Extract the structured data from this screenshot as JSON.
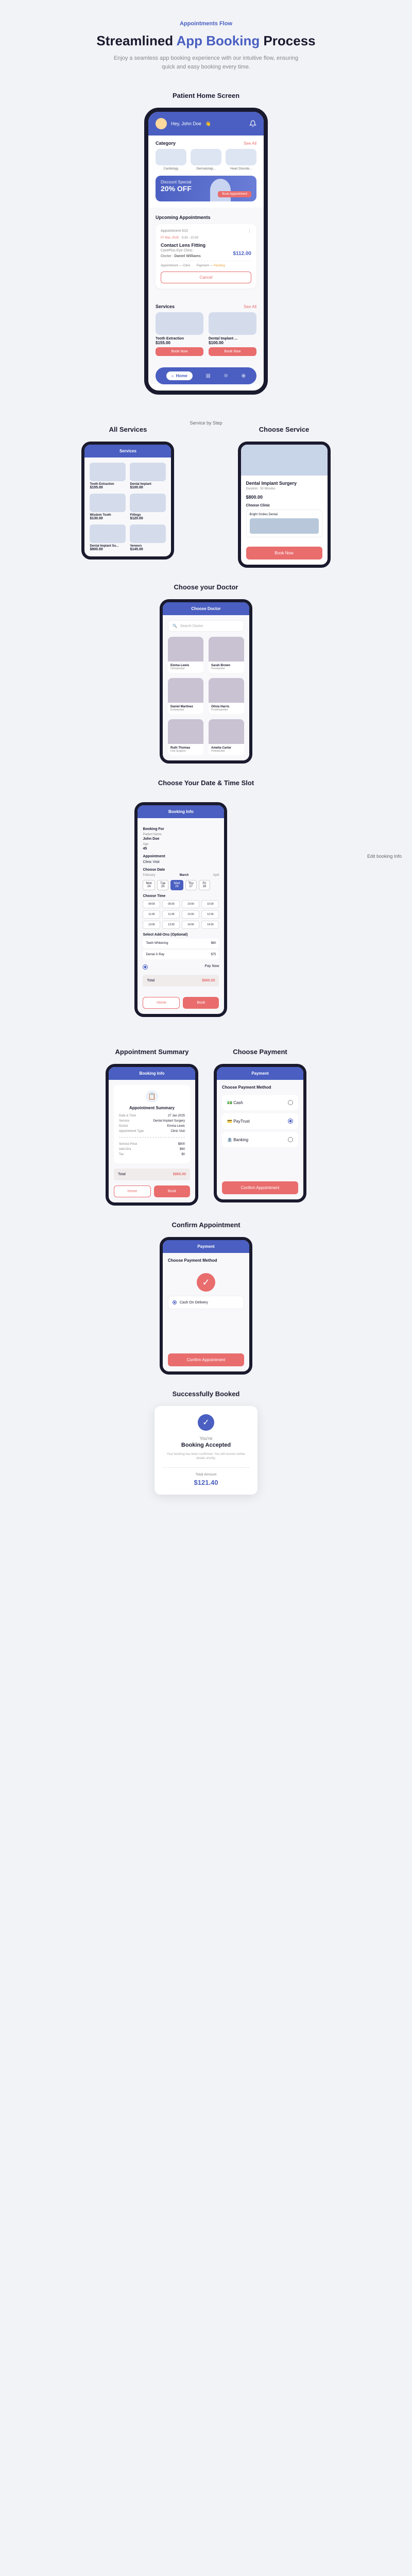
{
  "tag": "Appointments Flow",
  "title_pre": "Streamlined ",
  "title_accent": "App Booking",
  "title_post": " Process",
  "subtitle": "Enjoy a seamless app booking experience with our intuitive flow, ensuring quick and easy booking every time.",
  "labels": {
    "patient_home": "Patient Home Screen",
    "all_services": "All Services",
    "choose_service": "Choose Service",
    "choose_doctor": "Choose your Doctor",
    "choose_date": "Choose Your Date & Time Slot",
    "summary": "Appointment Summary",
    "choose_payment": "Choose Payment",
    "confirm": "Confirm Appointment",
    "success": "Successfully Booked",
    "service_by_step": "Service by Step",
    "edit_booking": "Edit booking Info"
  },
  "home": {
    "greeting": "Hey, John Doe",
    "category": "Category",
    "see_all": "See All",
    "cats": [
      "Cardiology",
      "Dermatologi...",
      "Heart Disorde..."
    ],
    "banner_label": "Discount Special",
    "banner_pct": "20% OFF",
    "banner_btn": "Book Appointment",
    "upcoming": "Upcoming Appointments",
    "appt_id": "Appointment #10",
    "appt_date": "07 Mar, 2025",
    "appt_time": "9:30 - 10:30",
    "appt_title": "Contact Lens Fitting",
    "appt_clinic": "CarePlus Eye Clinic",
    "doctor_label": "Doctor",
    "doctor_name": "Daniel Williams",
    "price": "$112.00",
    "meta_appt": "Appointment — Clinic",
    "meta_pay": "Payment — ",
    "meta_status": "Pending",
    "cancel": "Cancel",
    "services": "Services",
    "svc1_name": "Tooth Extraction",
    "svc1_price": "$155.00",
    "svc2_name": "Dental Implant ...",
    "svc2_price": "$100.00",
    "book_now": "Book Now",
    "nav_home": "Home"
  },
  "all_svc": {
    "header": "Services",
    "items": [
      {
        "name": "Tooth Extraction",
        "price": "$155.00"
      },
      {
        "name": "Dental Implant",
        "price": "$100.00"
      },
      {
        "name": "Wisdom Tooth",
        "price": "$130.00"
      },
      {
        "name": "Fillings",
        "price": "$120.00"
      },
      {
        "name": "Dental Implant Su...",
        "price": "$800.00"
      },
      {
        "name": "Veneers",
        "price": "$145.00"
      }
    ]
  },
  "svc_detail": {
    "title": "Dental Implant Surgery",
    "duration": "Duration : 50 Minutes",
    "price": "$800.00",
    "clinic_label": "Choose Clinic",
    "clinic_name": "Bright Smiles Dental",
    "book": "Book Now"
  },
  "doctor": {
    "header": "Choose Doctor",
    "search": "Search Doctor",
    "list": [
      {
        "name": "Emma Lewis",
        "role": "Orthodontist"
      },
      {
        "name": "Sarah Brown",
        "role": "Periodontist"
      },
      {
        "name": "Daniel Martinez",
        "role": "Endodontist"
      },
      {
        "name": "Olivia Harris",
        "role": "Prosthodontist"
      },
      {
        "name": "Ruth Thomas",
        "role": "Oral Surgeon"
      },
      {
        "name": "Amelia Carter",
        "role": "Pedodontist"
      }
    ]
  },
  "booking": {
    "header": "Booking Info",
    "booking_for": "Booking For",
    "patient_name": "Patient Name",
    "patient_val": "John Doe",
    "age": "Age",
    "age_val": "45",
    "appointment": "Appointment",
    "appt_type": "Clinic Visit",
    "choose_date": "Choose Date",
    "month_prev": "February",
    "month_cur": "March",
    "month_next": "April",
    "days": [
      {
        "d": "Mon",
        "n": "24"
      },
      {
        "d": "Tue",
        "n": "25"
      },
      {
        "d": "Wed",
        "n": "26"
      },
      {
        "d": "Thu",
        "n": "27"
      },
      {
        "d": "Fri",
        "n": "28"
      }
    ],
    "active_day": 2,
    "choose_time": "Choose Time",
    "slots": [
      "09:00",
      "09:30",
      "10:00",
      "10:30",
      "11:00",
      "11:30",
      "12:00",
      "12:30",
      "13:00",
      "13:30",
      "14:00",
      "14:30"
    ],
    "addons": "Select Add-Ons (Optional)",
    "addon1": "Teeth Whitening",
    "addon1_price": "$60",
    "addon2": "Dental X-Ray",
    "addon2_price": "$75",
    "pay_now": "Pay Now",
    "total_label": "Total",
    "total": "$860.00",
    "home": "Home",
    "book": "Book"
  },
  "summary": {
    "header": "Booking Info",
    "card_title": "Appointment Summary",
    "rows": [
      {
        "k": "Date & Time",
        "v": "27 Jan 2025"
      },
      {
        "k": "Service",
        "v": "Dental Implant Surgery"
      },
      {
        "k": "Doctor",
        "v": "Emma Lewis"
      },
      {
        "k": "Appointment Type",
        "v": "Clinic Visit"
      }
    ],
    "price_rows": [
      {
        "k": "Service Price",
        "v": "$800"
      },
      {
        "k": "Add-Ons",
        "v": "$60"
      },
      {
        "k": "Tax",
        "v": "$0"
      }
    ],
    "total_label": "Total",
    "total": "$860.00",
    "home": "Home",
    "book": "Book"
  },
  "payment": {
    "header": "Payment",
    "choose": "Choose Payment Method",
    "opts": [
      "Cash",
      "PayTrust",
      "Banking"
    ],
    "selected": 1,
    "confirm": "Confirm Appointment"
  },
  "confirm": {
    "header": "Payment",
    "prompt": "Choose Payment Method",
    "opt": "Cash On Delivery",
    "confirm": "Confirm Appointment"
  },
  "receipt": {
    "pre": "You're",
    "status": "Booking Accepted",
    "desc": "Your booking has been confirmed. You will receive further details shortly.",
    "total_label": "Total Amount",
    "total": "$121.40"
  }
}
